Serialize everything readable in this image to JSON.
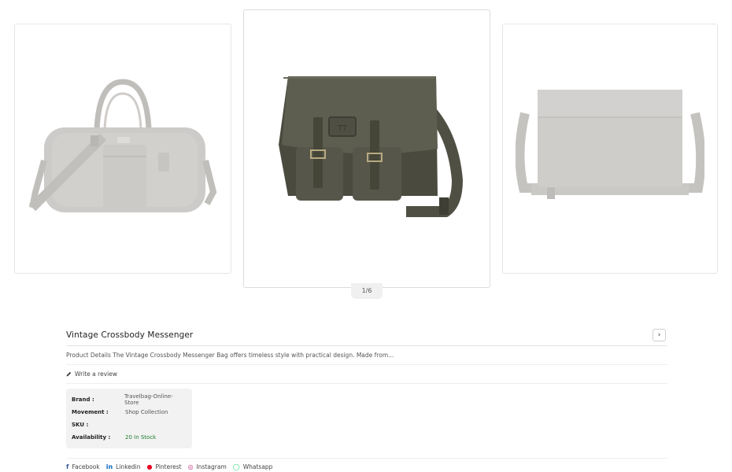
{
  "carousel": {
    "counter": "1/6",
    "slides": [
      {
        "icon": "duffel-bag-image"
      },
      {
        "icon": "messenger-bag-image"
      },
      {
        "icon": "messenger-bag-back-image"
      }
    ]
  },
  "product": {
    "title": "Vintage Crossbody Messenger",
    "next_icon": "›",
    "description": "Product Details The Vintage Crossbody Messenger Bag offers timeless style with practical design. Made from...",
    "write_review": "Write a review",
    "specs": [
      {
        "key": "Brand :",
        "value": "Travelbag-Online-Store"
      },
      {
        "key": "Movement :",
        "value": "Shop Collection"
      },
      {
        "key": "SKU :",
        "value": ""
      },
      {
        "key": "Availability :",
        "value": "20 In Stock"
      }
    ]
  },
  "share": {
    "facebook": "Facebook",
    "linkedin": "Linkedin",
    "pinterest": "Pinterest",
    "instagram": "Instagram",
    "whatsapp": "Whatsapp"
  },
  "colors": {
    "stock": "#1e7b2f",
    "bag_center": "#5a5a4c",
    "bag_faded": "#9a9792"
  }
}
